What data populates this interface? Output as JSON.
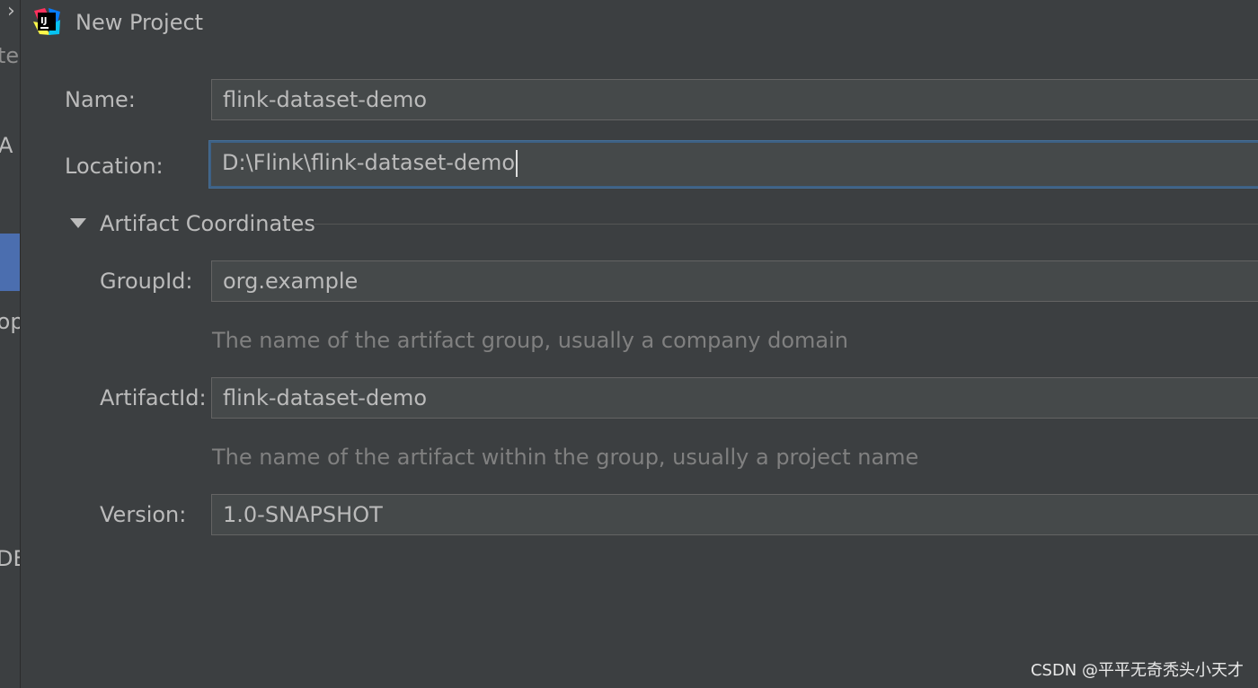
{
  "window": {
    "title": "New Project",
    "icon": "intellij-idea-icon",
    "icon_letters": "IJ"
  },
  "left_strip": {
    "chevron": "›",
    "fragments": [
      "te",
      "A",
      "lop",
      "DE"
    ]
  },
  "form": {
    "name": {
      "label": "Name:",
      "value": "flink-dataset-demo"
    },
    "location": {
      "label": "Location:",
      "value": "D:\\Flink\\flink-dataset-demo"
    }
  },
  "artifact_coordinates": {
    "title": "Artifact Coordinates",
    "expanded": true,
    "group_id": {
      "label": "GroupId:",
      "value": "org.example",
      "hint": "The name of the artifact group, usually a company domain"
    },
    "artifact_id": {
      "label": "ArtifactId:",
      "value": "flink-dataset-demo",
      "hint": "The name of the artifact within the group, usually a project name"
    },
    "version": {
      "label": "Version:",
      "value": "1.0-SNAPSHOT"
    }
  },
  "watermark": "CSDN @平平无奇秃头小天才",
  "colors": {
    "background": "#3c3f41",
    "field_background": "#45494a",
    "focus_border": "#3d6185",
    "selection": "#4b6eaf",
    "text": "#bbbbbb",
    "hint_text": "#808080"
  }
}
